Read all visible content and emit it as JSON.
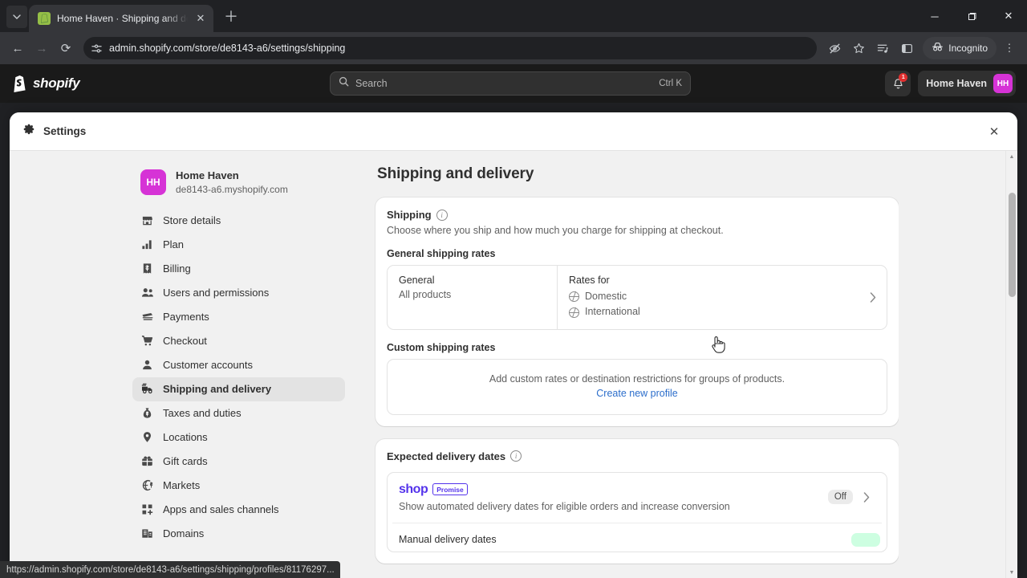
{
  "browser": {
    "tab": {
      "title": "Home Haven · Shipping and de",
      "favicon_icon": "shopify-bag-icon",
      "close_icon": "close-icon",
      "new_tab_icon": "plus-icon",
      "tab_list_icon": "chevron-down-icon"
    },
    "nav": {
      "back_icon": "arrow-left-icon",
      "forward_icon": "arrow-right-icon",
      "reload_icon": "reload-icon"
    },
    "omnibox": {
      "site_settings_icon": "tune-icon",
      "url": "admin.shopify.com/store/de8143-a6/settings/shipping"
    },
    "actions": {
      "tracking_protection_icon": "eye-slash-icon",
      "bookmark_icon": "star-icon",
      "reading_list_icon": "split-list-icon",
      "side_panel_icon": "side-panel-icon",
      "incognito_label": "Incognito",
      "incognito_icon": "incognito-icon",
      "menu_icon": "kebab-menu-icon"
    },
    "window": {
      "minimize_icon": "minimize-icon",
      "maximize_icon": "maximize-icon",
      "close_icon": "window-close-icon"
    },
    "status_url": "https://admin.shopify.com/store/de8143-a6/settings/shipping/profiles/81176297..."
  },
  "appbar": {
    "logo_text": "shopify",
    "logo_icon": "shopify-bag-icon",
    "search": {
      "placeholder": "Search",
      "icon": "search-icon",
      "shortcut": "Ctrl K"
    },
    "notifications": {
      "icon": "bell-icon",
      "count": "1"
    },
    "store": {
      "name": "Home Haven",
      "initials": "HH",
      "avatar_color": "#d633d6"
    }
  },
  "modal": {
    "title": "Settings",
    "gear_icon": "gear-icon",
    "close_icon": "close-icon"
  },
  "sidebar": {
    "store": {
      "initials": "HH",
      "name": "Home Haven",
      "domain": "de8143-a6.myshopify.com"
    },
    "items": [
      {
        "label": "Store details",
        "icon": "store-icon",
        "active": false
      },
      {
        "label": "Plan",
        "icon": "chart-bar-icon",
        "active": false
      },
      {
        "label": "Billing",
        "icon": "bill-icon",
        "active": false
      },
      {
        "label": "Users and permissions",
        "icon": "users-icon",
        "active": false
      },
      {
        "label": "Payments",
        "icon": "payments-icon",
        "active": false
      },
      {
        "label": "Checkout",
        "icon": "cart-icon",
        "active": false
      },
      {
        "label": "Customer accounts",
        "icon": "person-icon",
        "active": false
      },
      {
        "label": "Shipping and delivery",
        "icon": "delivery-van-icon",
        "active": true
      },
      {
        "label": "Taxes and duties",
        "icon": "tax-bag-icon",
        "active": false
      },
      {
        "label": "Locations",
        "icon": "pin-icon",
        "active": false
      },
      {
        "label": "Gift cards",
        "icon": "gift-card-icon",
        "active": false
      },
      {
        "label": "Markets",
        "icon": "globe-money-icon",
        "active": false
      },
      {
        "label": "Apps and sales channels",
        "icon": "apps-grid-icon",
        "active": false
      },
      {
        "label": "Domains",
        "icon": "domain-icon",
        "active": false
      }
    ]
  },
  "main": {
    "page_title": "Shipping and delivery",
    "shipping_card": {
      "title": "Shipping",
      "info_icon": "info-icon",
      "subtitle": "Choose where you ship and how much you charge for shipping at checkout.",
      "general_rates_label": "General shipping rates",
      "profile": {
        "name": "General",
        "scope": "All products",
        "rates_for_label": "Rates for",
        "destinations": [
          {
            "label": "Domestic",
            "icon": "globe-icon"
          },
          {
            "label": "International",
            "icon": "globe-icon"
          }
        ],
        "chevron_icon": "chevron-right-icon"
      },
      "custom_rates_label": "Custom shipping rates",
      "custom_empty_text": "Add custom rates or destination restrictions for groups of products.",
      "custom_empty_link": "Create new profile"
    },
    "delivery_card": {
      "title": "Expected delivery dates",
      "info_icon": "info-icon",
      "shop_promise": {
        "brand": "shop",
        "badge": "Promise",
        "description": "Show automated delivery dates for eligible orders and increase conversion",
        "status": "Off",
        "chevron_icon": "chevron-right-icon"
      },
      "manual": {
        "label": "Manual delivery dates"
      }
    }
  },
  "colors": {
    "accent_link": "#2c6ecb",
    "brand_magenta": "#d633d6",
    "shop_purple": "#5433eb",
    "badge_green": "#cdfee1",
    "chrome_dark": "#202124"
  }
}
